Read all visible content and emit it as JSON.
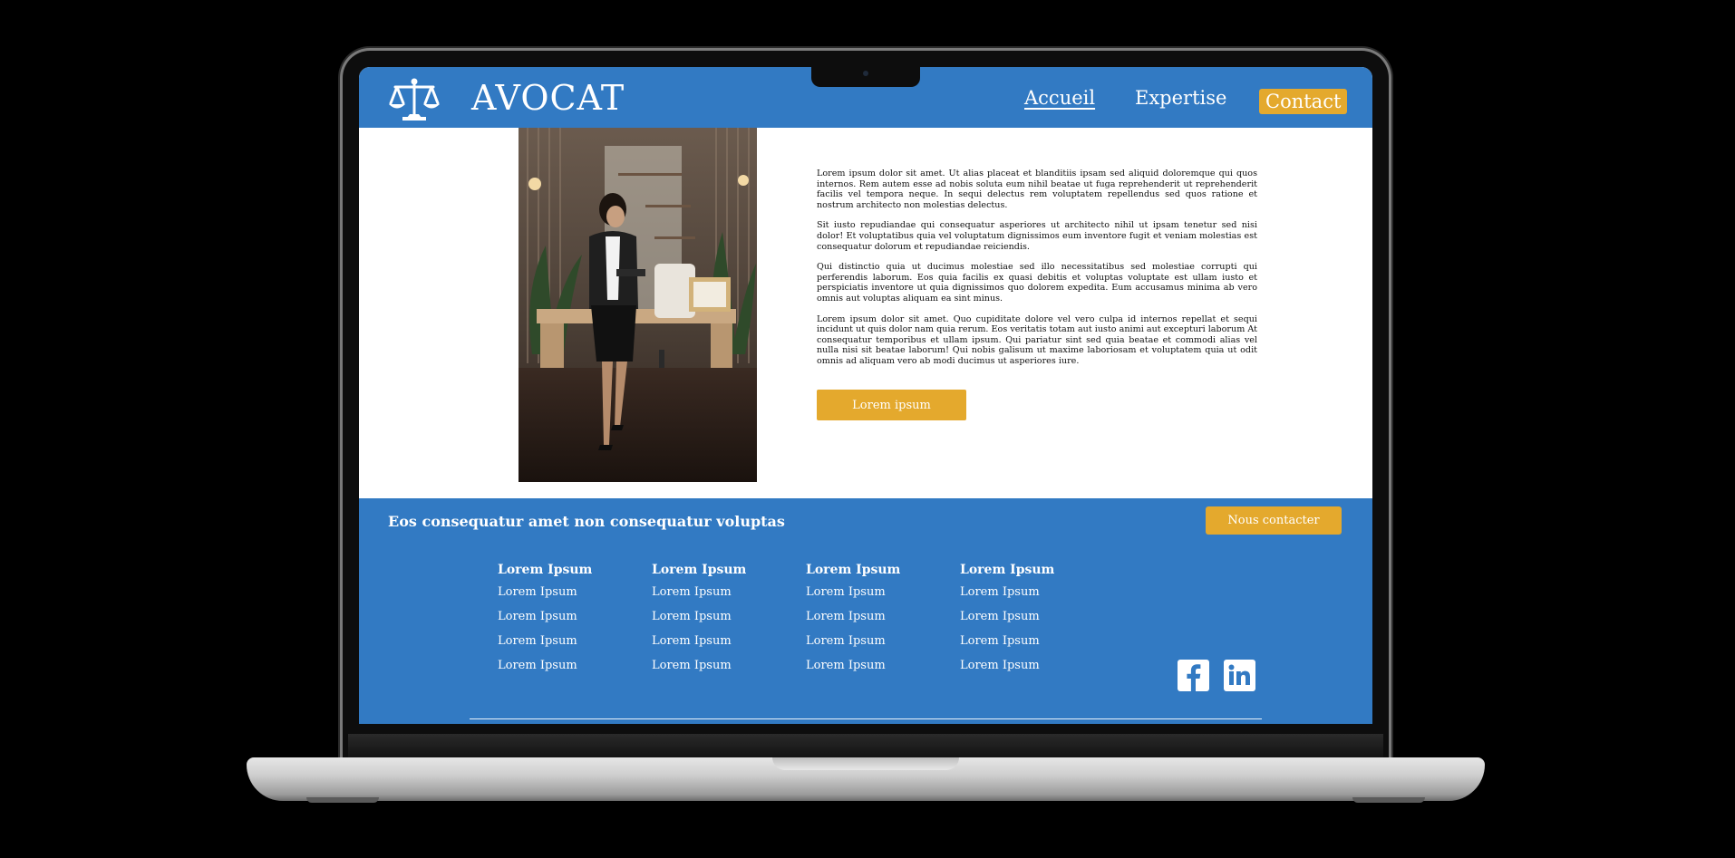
{
  "header": {
    "brand": "AVOCAT",
    "nav": {
      "home": "Accueil",
      "expertise": "Expertise",
      "contact": "Contact"
    }
  },
  "article": {
    "paragraphs": [
      "Lorem ipsum dolor sit amet. Ut alias placeat et blanditiis ipsam sed aliquid doloremque qui quos internos. Rem autem esse ad nobis soluta eum nihil beatae ut fuga reprehenderit ut reprehenderit facilis vel tempora neque. In sequi delectus rem voluptatem repellendus sed quos ratione et nostrum architecto non molestias delectus.",
      "Sit iusto repudiandae qui consequatur asperiores ut architecto nihil ut ipsam tenetur sed nisi dolor! Et voluptatibus quia vel voluptatum dignissimos eum inventore fugit et veniam molestias est consequatur dolorum et repudiandae reiciendis.",
      "Qui distinctio quia ut ducimus molestiae sed illo necessitatibus sed molestiae corrupti qui perferendis laborum. Eos quia facilis ex quasi debitis et voluptas voluptate est ullam iusto et perspiciatis inventore ut quia dignissimos quo dolorem expedita. Eum accusamus minima ab vero omnis aut voluptas aliquam ea sint minus.",
      "Lorem ipsum dolor sit amet. Quo cupiditate dolore vel vero culpa id internos repellat et sequi incidunt ut quis dolor nam quia rerum. Eos veritatis totam aut iusto animi aut excepturi laborum At consequatur temporibus et ullam ipsum. Qui pariatur sint sed quia beatae et commodi alias vel nulla nisi sit beatae laborum! Qui nobis galisum ut maxime laboriosam et voluptatem quia ut odit omnis ad aliquam vero ab modi ducimus ut asperiores iure."
    ],
    "button": "Lorem ipsum"
  },
  "footer": {
    "tagline": "Eos consequatur amet non consequatur voluptas",
    "contact_button": "Nous contacter",
    "columns": [
      {
        "title": "Lorem Ipsum",
        "links": [
          "Lorem Ipsum",
          "Lorem Ipsum",
          "Lorem Ipsum",
          "Lorem Ipsum"
        ]
      },
      {
        "title": "Lorem Ipsum",
        "links": [
          "Lorem Ipsum",
          "Lorem Ipsum",
          "Lorem Ipsum",
          "Lorem Ipsum"
        ]
      },
      {
        "title": "Lorem Ipsum",
        "links": [
          "Lorem Ipsum",
          "Lorem Ipsum",
          "Lorem Ipsum",
          "Lorem Ipsum"
        ]
      },
      {
        "title": "Lorem Ipsum",
        "links": [
          "Lorem Ipsum",
          "Lorem Ipsum",
          "Lorem Ipsum",
          "Lorem Ipsum"
        ]
      }
    ],
    "social_icons": [
      "facebook-icon",
      "linkedin-icon"
    ]
  },
  "colors": {
    "primary_blue": "#327ac3",
    "accent_gold": "#e4a92d",
    "text_dark": "#111111",
    "white": "#ffffff"
  }
}
